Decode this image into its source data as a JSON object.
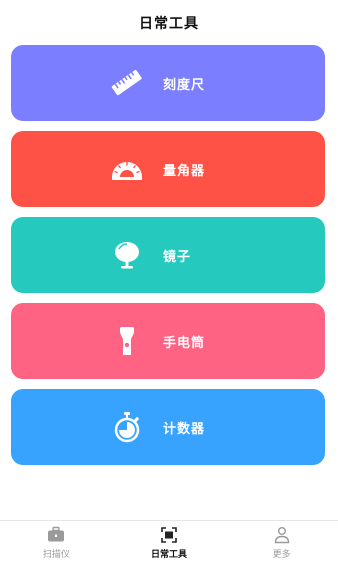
{
  "header": {
    "title": "日常工具"
  },
  "tools": [
    {
      "label": "刻度尺",
      "color": "#7b7fff",
      "icon": "ruler-icon"
    },
    {
      "label": "量角器",
      "color": "#ff5246",
      "icon": "protractor-icon"
    },
    {
      "label": "镜子",
      "color": "#26c9bd",
      "icon": "mirror-icon"
    },
    {
      "label": "手电筒",
      "color": "#ff6383",
      "icon": "flashlight-icon"
    },
    {
      "label": "计数器",
      "color": "#37a3ff",
      "icon": "stopwatch-icon"
    }
  ],
  "tabbar": {
    "tabs": [
      {
        "label": "扫描仪",
        "icon": "briefcase-icon",
        "active": false
      },
      {
        "label": "日常工具",
        "icon": "scan-frame-icon",
        "active": true
      },
      {
        "label": "更多",
        "icon": "person-icon",
        "active": false
      }
    ]
  }
}
